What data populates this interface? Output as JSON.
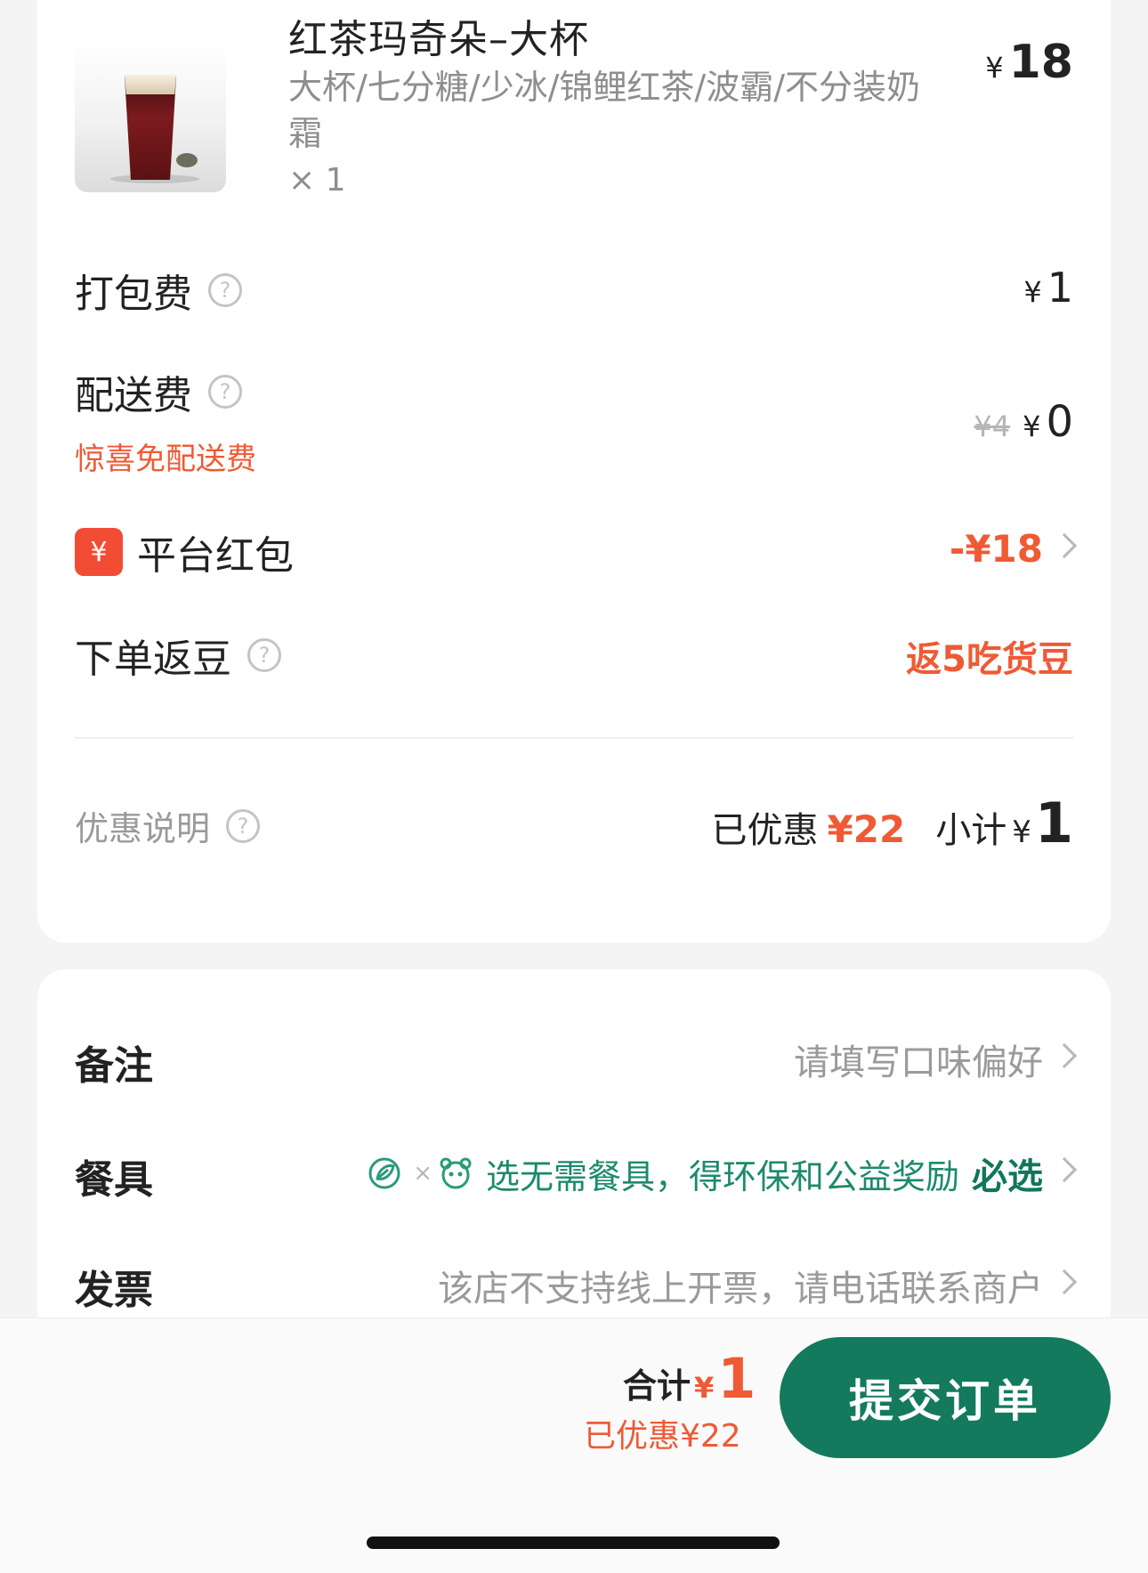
{
  "product": {
    "title": "红茶玛奇朵–大杯",
    "spec": "大杯/七分糖/少冰/锦鲤红茶/波霸/不分装奶霜",
    "qty": "× 1",
    "price_symbol": "¥",
    "price": "18"
  },
  "fees": {
    "packing": {
      "label": "打包费",
      "symbol": "¥",
      "value": "1"
    },
    "delivery": {
      "label": "配送费",
      "promo": "惊喜免配送费",
      "original": "¥4",
      "symbol": "¥",
      "value": "0"
    },
    "red_packet": {
      "badge": "¥",
      "label": "平台红包",
      "value": "-¥18"
    },
    "beans": {
      "label": "下单返豆",
      "value": "返5吃货豆"
    }
  },
  "discount": {
    "info_label": "优惠说明",
    "saved_label": "已优惠",
    "saved_value": "¥22",
    "subtotal_label": "小计",
    "subtotal_symbol": "¥",
    "subtotal_value": "1"
  },
  "options": {
    "note": {
      "label": "备注",
      "placeholder": "请填写口味偏好"
    },
    "utensils": {
      "label": "餐具",
      "hint": "选无需餐具，得环保和公益奖励",
      "action": "必选"
    },
    "invoice": {
      "label": "发票",
      "text": "该店不支持线上开票，请电话联系商户"
    }
  },
  "footer": {
    "total_label": "合计",
    "total_symbol": "¥",
    "total_value": "1",
    "saved_text": "已优惠¥22",
    "submit_label": "提交订单"
  },
  "icons": {
    "question": "?",
    "leaf": "leaf-icon",
    "panda": "panda-icon"
  },
  "colors": {
    "accent_red": "#ef5a35",
    "brand_green": "#137a5d",
    "badge_red": "#f24c35"
  }
}
